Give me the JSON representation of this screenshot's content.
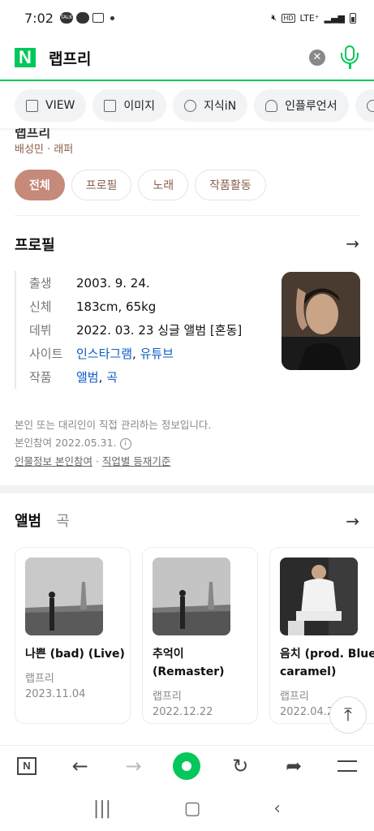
{
  "status": {
    "time": "7:02",
    "network": "LTE⁺",
    "hd": "HD"
  },
  "search": {
    "query": "랩프리"
  },
  "tabs": [
    {
      "label": "VIEW",
      "icon": "document-icon"
    },
    {
      "label": "이미지",
      "icon": "image-icon"
    },
    {
      "label": "지식iN",
      "icon": "q-bubble-icon"
    },
    {
      "label": "인플루언서",
      "icon": "person-icon"
    }
  ],
  "header": {
    "cutoff_title": "랩프리",
    "subtitle": "배성민 · 래퍼"
  },
  "chips": [
    "전체",
    "프로필",
    "노래",
    "작품활동"
  ],
  "profile": {
    "title": "프로필",
    "rows": [
      {
        "key": "출생",
        "value": "2003. 9. 24."
      },
      {
        "key": "신체",
        "value": "183cm, 65kg"
      },
      {
        "key": "데뷔",
        "value": "2022. 03. 23 싱글 앨범 [혼동]"
      },
      {
        "key": "사이트",
        "link1": "인스타그램",
        "sep": ", ",
        "link2": "유튜브"
      },
      {
        "key": "작품",
        "link1": "앨범",
        "sep": ", ",
        "link2": "곡"
      }
    ],
    "note1": "본인 또는 대리인이 직접 관리하는 정보입니다.",
    "note2": "본인참여 2022.05.31.",
    "note3a": "인물정보 본인참여",
    "note3sep": " · ",
    "note3b": "직업별 등재기준"
  },
  "albums": {
    "tab_on": "앨범",
    "tab_off": "곡",
    "items": [
      {
        "title": "나쁜 (bad) (Live)",
        "artist": "랩프리",
        "date": "2023.11.04"
      },
      {
        "title": "추억이 (Remaster)",
        "artist": "랩프리",
        "date": "2022.12.22"
      },
      {
        "title": "음치 (prod. Blue caramel)",
        "artist": "랩프리",
        "date": "2022.04.2"
      }
    ]
  },
  "colors": {
    "naver_green": "#03c75a",
    "chip_active": "#c58a7a",
    "link": "#0b5bc4"
  }
}
